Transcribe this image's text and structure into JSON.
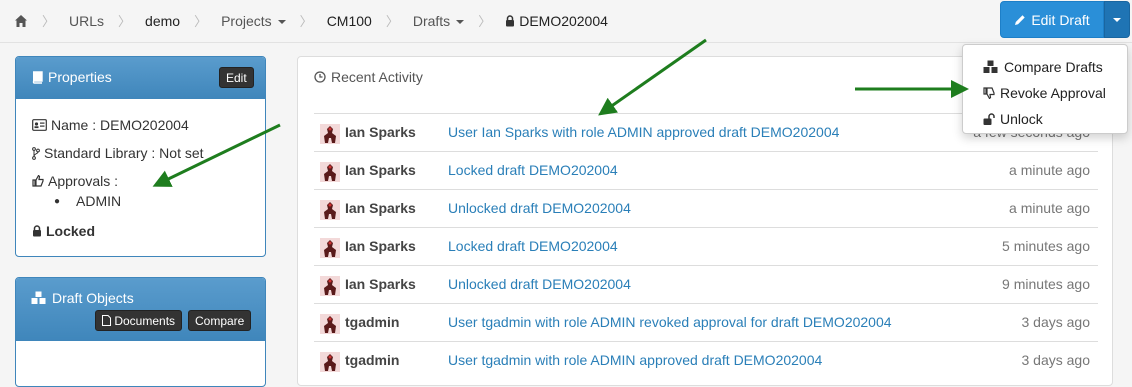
{
  "breadcrumb": {
    "items": [
      {
        "label": "URLs"
      },
      {
        "label": "demo"
      },
      {
        "label": "Projects"
      },
      {
        "label": "CM100"
      },
      {
        "label": "Drafts"
      },
      {
        "label": "DEMO202004"
      }
    ]
  },
  "edit_draft": {
    "label": "Edit Draft"
  },
  "dropdown": {
    "items": [
      {
        "label": "Compare Drafts",
        "icon": "cubes-icon"
      },
      {
        "label": "Revoke Approval",
        "icon": "thumbs-down-icon"
      },
      {
        "label": "Unlock",
        "icon": "unlock-icon"
      }
    ]
  },
  "properties": {
    "title": "Properties",
    "edit_label": "Edit",
    "name": "Name : DEMO202004",
    "standard_library": "Standard Library : Not set",
    "approvals_label": "Approvals :",
    "approvals": [
      "ADMIN"
    ],
    "locked": "Locked"
  },
  "draft_objects": {
    "title": "Draft Objects",
    "documents_label": "Documents",
    "compare_label": "Compare"
  },
  "activity": {
    "title": "Recent Activity",
    "rows": [
      {
        "user": "Ian Sparks",
        "message": "User Ian Sparks with role ADMIN approved draft DEMO202004",
        "time": "a few seconds ago"
      },
      {
        "user": "Ian Sparks",
        "message": "Locked draft DEMO202004",
        "time": "a minute ago"
      },
      {
        "user": "Ian Sparks",
        "message": "Unlocked draft DEMO202004",
        "time": "a minute ago"
      },
      {
        "user": "Ian Sparks",
        "message": "Locked draft DEMO202004",
        "time": "5 minutes ago"
      },
      {
        "user": "Ian Sparks",
        "message": "Unlocked draft DEMO202004",
        "time": "9 minutes ago"
      },
      {
        "user": "tgadmin",
        "message": "User tgadmin with role ADMIN revoked approval for draft DEMO202004",
        "time": "3 days ago"
      },
      {
        "user": "tgadmin",
        "message": "User tgadmin with role ADMIN approved draft DEMO202004",
        "time": "3 days ago"
      }
    ]
  },
  "colors": {
    "primary": "#2a8fd8",
    "panel_header": "#3f86bb",
    "link": "#2a7fb8",
    "arrow": "#1e7d1e"
  }
}
